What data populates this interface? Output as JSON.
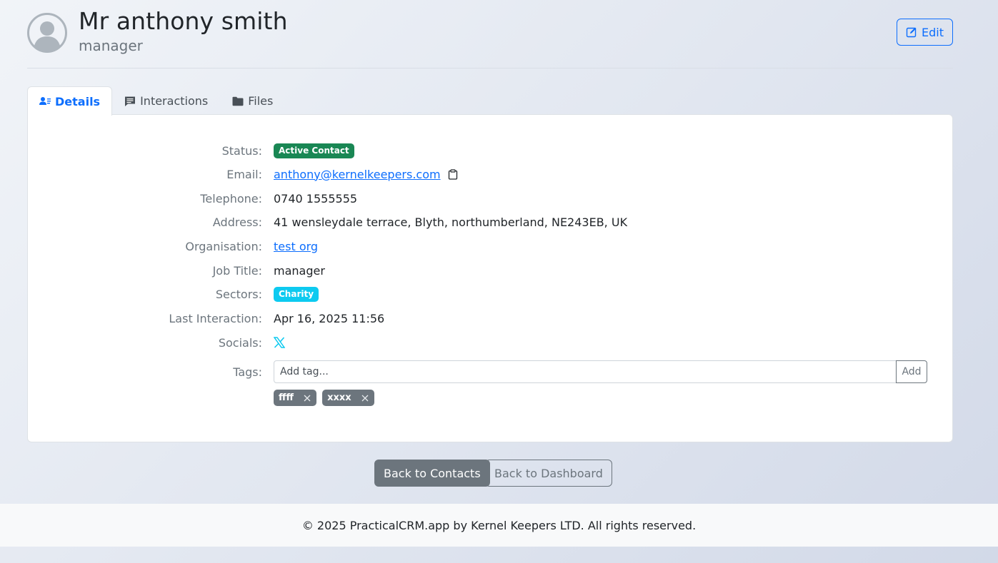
{
  "contact": {
    "name": "Mr anthony smith",
    "job_subtitle": "manager"
  },
  "header": {
    "edit_label": "Edit"
  },
  "tabs": [
    {
      "label": "Details",
      "icon": "user-details-icon",
      "active": true
    },
    {
      "label": "Interactions",
      "icon": "comment-icon",
      "active": false
    },
    {
      "label": "Files",
      "icon": "folder-icon",
      "active": false
    }
  ],
  "details": {
    "status": {
      "label": "Status:",
      "value": "Active Contact",
      "color": "#198754"
    },
    "email": {
      "label": "Email:",
      "value": "anthony@kernelkeepers.com"
    },
    "telephone": {
      "label": "Telephone:",
      "value": "0740 1555555"
    },
    "address": {
      "label": "Address:",
      "value": "41 wensleydale terrace, Blyth, northumberland, NE243EB, UK"
    },
    "organisation": {
      "label": "Organisation:",
      "value": "test org"
    },
    "job_title": {
      "label": "Job Title:",
      "value": "manager"
    },
    "sectors": {
      "label": "Sectors:",
      "value": "Charity",
      "color": "#0dcaf0"
    },
    "last_interaction": {
      "label": "Last Interaction:",
      "value": "Apr 16, 2025 11:56"
    },
    "socials": {
      "label": "Socials:",
      "icon": "x-twitter-icon"
    },
    "tags": {
      "label": "Tags:",
      "placeholder": "Add tag...",
      "add_label": "Add",
      "items": [
        "ffff",
        "xxxx"
      ]
    }
  },
  "actions": {
    "back_contacts": "Back to Contacts",
    "back_dashboard": "Back to Dashboard"
  },
  "footer": {
    "text": "© 2025 PracticalCRM.app by Kernel Keepers LTD. All rights reserved."
  },
  "colors": {
    "primary": "#0d6efd",
    "secondary": "#6c757d"
  }
}
